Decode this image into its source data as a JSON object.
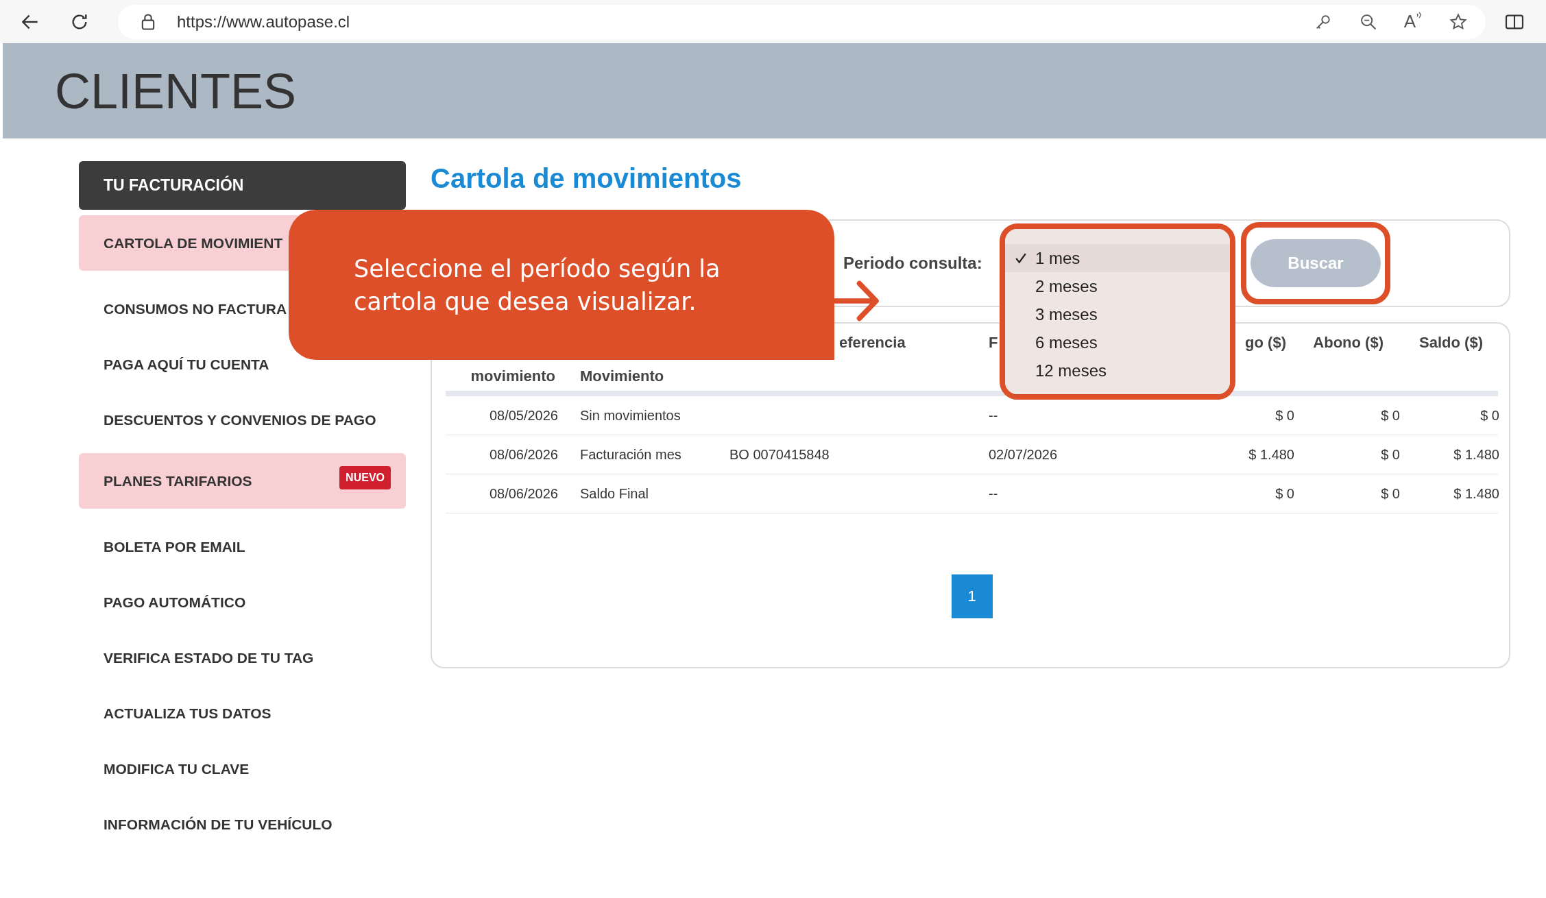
{
  "browser": {
    "url": "https://www.autopase.cl",
    "read_aloud_glyph": "A"
  },
  "header": {
    "title": "CLIENTES"
  },
  "sidebar": {
    "heading": "TU FACTURACIÓN",
    "items": [
      {
        "label": "CARTOLA DE MOVIMIENT",
        "highlighted": true
      },
      {
        "label": "CONSUMOS NO FACTURA",
        "highlighted": false
      },
      {
        "label": "PAGA AQUÍ TU CUENTA",
        "highlighted": false
      },
      {
        "label": "DESCUENTOS Y CONVENIOS DE PAGO",
        "highlighted": false
      },
      {
        "label": "PLANES TARIFARIOS",
        "highlighted": true,
        "badge": "NUEVO"
      },
      {
        "label": "BOLETA POR EMAIL",
        "highlighted": false
      },
      {
        "label": "PAGO AUTOMÁTICO",
        "highlighted": false
      },
      {
        "label": "VERIFICA ESTADO DE TU TAG",
        "highlighted": false
      },
      {
        "label": "ACTUALIZA TUS DATOS",
        "highlighted": false
      },
      {
        "label": "MODIFICA TU CLAVE",
        "highlighted": false
      },
      {
        "label": "INFORMACIÓN DE TU VEHÍCULO",
        "highlighted": false
      }
    ]
  },
  "page": {
    "title": "Cartola de movimientos"
  },
  "filter": {
    "label": "Periodo consulta:",
    "options": [
      {
        "label": "1 mes",
        "selected": true
      },
      {
        "label": "2 meses",
        "selected": false
      },
      {
        "label": "3 meses",
        "selected": false
      },
      {
        "label": "6 meses",
        "selected": false
      },
      {
        "label": "12 meses",
        "selected": false
      }
    ],
    "button": "Buscar"
  },
  "callout": {
    "text": "Seleccione el período según la cartola que desea visualizar."
  },
  "table": {
    "columns": [
      "movimiento",
      "Movimiento",
      "eferencia",
      "F",
      "go ($)",
      "Abono ($)",
      "Saldo ($)"
    ],
    "rows": [
      {
        "date": "08/05/2026",
        "movement": "Sin movimientos",
        "due": "--",
        "charge": "$ 0",
        "credit": "$ 0",
        "balance": "$ 0"
      },
      {
        "date": "08/06/2026",
        "movement": "Facturación mes",
        "reference": "BO 0070415848",
        "due": "02/07/2026",
        "charge": "$ 1.480",
        "credit": "$ 0",
        "balance": "$ 1.480"
      },
      {
        "date": "08/06/2026",
        "movement": "Saldo Final",
        "due": "--",
        "charge": "$ 0",
        "credit": "$ 0",
        "balance": "$ 1.480"
      }
    ]
  },
  "pagination": {
    "pages": [
      {
        "label": "1",
        "selected": true
      }
    ]
  }
}
